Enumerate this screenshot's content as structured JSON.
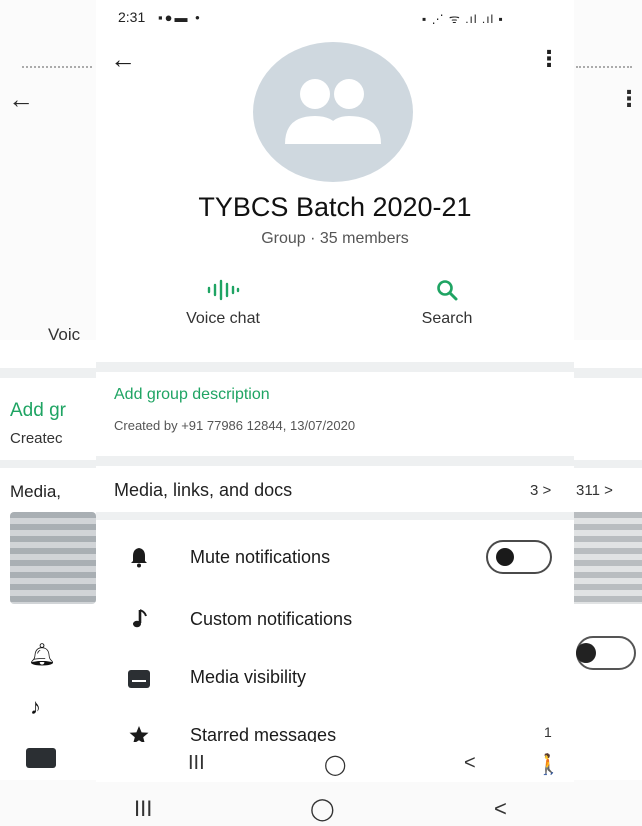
{
  "status_bar": {
    "time": "2:31",
    "left_icons": "▪●▬ •",
    "right_icons": "▪ ⋰ ᯤ .ıl .ıl ▪"
  },
  "header": {
    "back_icon": "arrow-left-icon",
    "menu_icon": "kebab-menu-icon"
  },
  "group": {
    "name": "TYBCS Batch 2020-21",
    "subtitle": "Group · 35 members",
    "avatar_color": "#cfd8df"
  },
  "actions": [
    {
      "label": "Voice chat",
      "icon": "voice-wave-icon"
    },
    {
      "label": "Search",
      "icon": "search-icon"
    }
  ],
  "description": {
    "add_label": "Add group description",
    "created": "Created by +91 77986 12844, 13/07/2020"
  },
  "media": {
    "label": "Media, links, and docs",
    "count": "3 >"
  },
  "settings": [
    {
      "label": "Mute notifications",
      "icon": "bell-icon",
      "toggle": false
    },
    {
      "label": "Custom notifications",
      "icon": "music-note-icon"
    },
    {
      "label": "Media visibility",
      "icon": "image-icon"
    },
    {
      "label": "Starred messages",
      "icon": "star-icon",
      "count": "1"
    }
  ],
  "phone_nav": {
    "recents": "III",
    "home": "◯",
    "back": "<",
    "accessibility": "🚶"
  },
  "background": {
    "voice": "Voic",
    "add_group": "Add gr",
    "created": "Createc",
    "media": "Media,",
    "count": "311 >",
    "nav_recents": "III",
    "nav_home": "◯",
    "nav_back": "<"
  },
  "colors": {
    "accent": "#1fa463",
    "divider": "#eef0f1"
  }
}
